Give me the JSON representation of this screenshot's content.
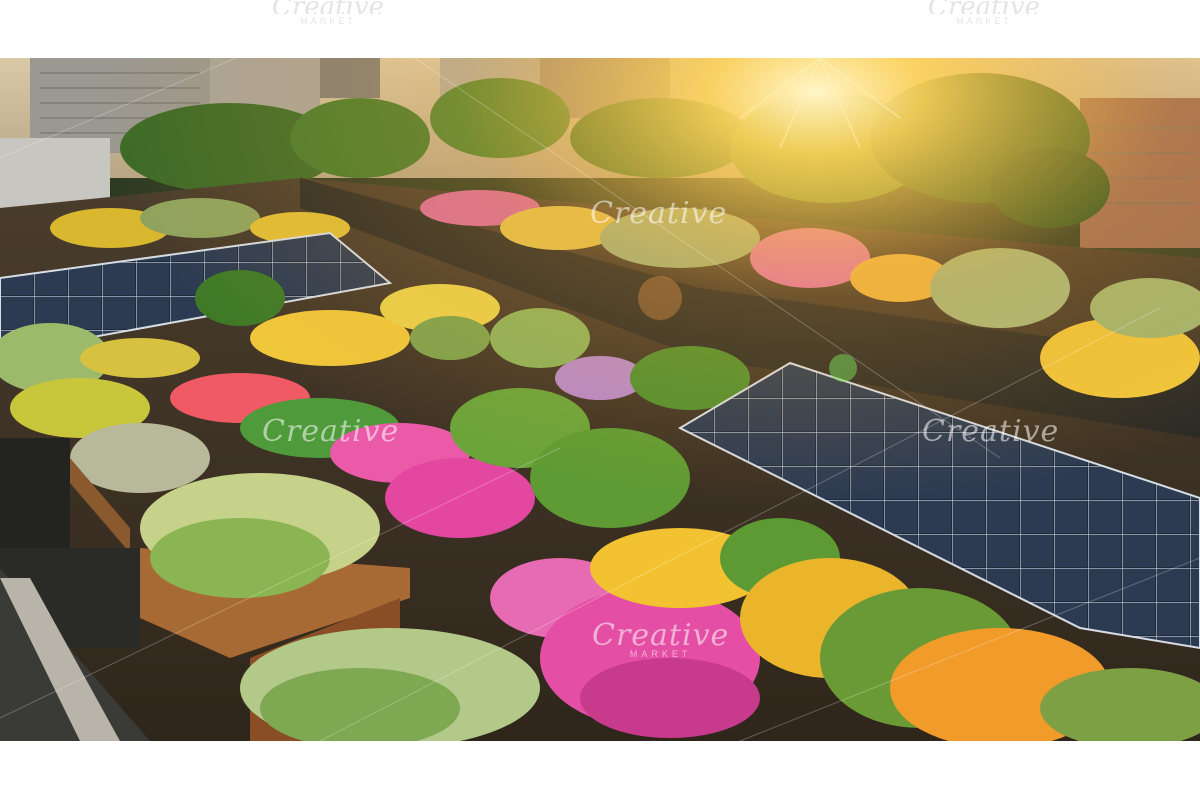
{
  "watermark": {
    "brand": "Creative",
    "sub": "MARKET"
  },
  "photo": {
    "subject": "rooftop-garden-with-solar-panels",
    "sun_color": "#ffd35a",
    "foliage_color": "#3f7a2a",
    "flower_colors": [
      "#e8409a",
      "#f2c230",
      "#f29b2a",
      "#b889c9"
    ],
    "panel_color": "#1f2a3a"
  }
}
